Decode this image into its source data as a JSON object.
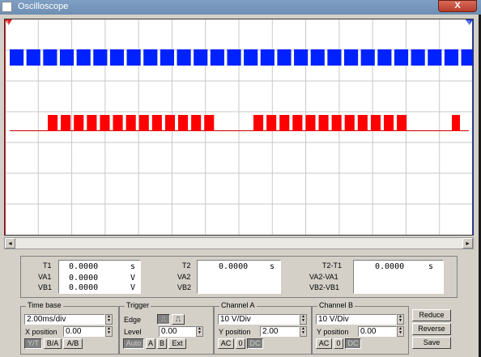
{
  "window": {
    "title": "Oscilloscope",
    "close_label": "X"
  },
  "markers": {
    "t1": "1",
    "t2": "2"
  },
  "traces": {
    "channel_a_color": "#0022ff",
    "channel_b_color": "#ff0000",
    "channel_b_baseline_color": "#cc0000",
    "grid_color": "#c8c8c8"
  },
  "readout": {
    "t1_label": "T1",
    "va1_label": "VA1",
    "vb1_label": "VB1",
    "t1_value": "0.0000",
    "t1_unit": "s",
    "va1_value": "0.0000",
    "va1_unit": "V",
    "vb1_value": "0.0000",
    "vb1_unit": "V",
    "t2_label": "T2",
    "va2_label": "VA2",
    "vb2_label": "VB2",
    "t2_value": "0.0000",
    "t2_unit": "s",
    "diff_t_label": "T2-T1",
    "diff_va_label": "VA2-VA1",
    "diff_vb_label": "VB2-VB1",
    "diff_t_value": "0.0000",
    "diff_t_unit": "s"
  },
  "timebase": {
    "title": "Time base",
    "scale": "2.00ms/div",
    "xpos_label": "X position",
    "xpos_value": "0.00",
    "modes": [
      "Y/T",
      "B/A",
      "A/B"
    ]
  },
  "trigger": {
    "title": "Trigger",
    "edge_label": "Edge",
    "level_label": "Level",
    "level_value": "0.00",
    "sources": [
      "Auto",
      "A",
      "B",
      "Ext"
    ]
  },
  "channel_a": {
    "title": "Channel A",
    "scale": "10 V/Div",
    "ypos_label": "Y position",
    "ypos_value": "2.00",
    "coupling": [
      "AC",
      "0",
      "DC"
    ]
  },
  "channel_b": {
    "title": "Channel B",
    "scale": "10 V/Div",
    "ypos_label": "Y position",
    "ypos_value": "0.00",
    "coupling": [
      "AC",
      "0",
      "DC"
    ]
  },
  "actions": {
    "reduce": "Reduce",
    "reverse": "Reverse",
    "save": "Save"
  }
}
